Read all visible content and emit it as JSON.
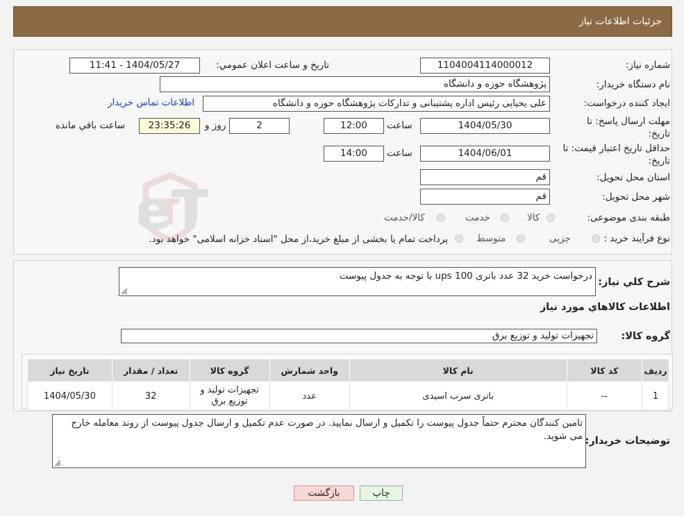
{
  "header": {
    "title": "جزئیات اطلاعات نیاز"
  },
  "form": {
    "need_number_label": "شماره نیاز:",
    "need_number": "1104004114000012",
    "announce_label": "تاریخ و ساعت اعلان عمومي:",
    "announce_value": "1404/05/27 - 11:41",
    "buyer_org_label": "نام دستگاه خریدار:",
    "buyer_org": "پژوهشگاه حوزه و دانشگاه",
    "requester_label": "ایجاد کننده درخواست:",
    "requester": "علی یحیایی رئیس اداره پشتیبانی و تدارکات پژوهشگاه حوزه و دانشگاه",
    "contact_link": "اطلاعات تماس خریدار",
    "reply_deadline_label": "مهلت ارسال پاسخ: تا تاریخ:",
    "reply_date": "1404/05/30",
    "time_label": "ساعت",
    "reply_time": "12:00",
    "days": "2",
    "days_label": "روز و",
    "remaining": "23:35:26",
    "remaining_label": "ساعت باقي مانده",
    "price_validity_label": "حداقل تاریخ اعتبار قیمت: تا تاریخ:",
    "validity_date": "1404/06/01",
    "validity_time": "14:00",
    "province_label": "استان محل تحویل:",
    "province": "قم",
    "city_label": "شهر محل تحویل:",
    "city": "قم",
    "category_label": "طبقه بندی موضوعی:",
    "category_options": [
      "کالا",
      "خدمت",
      "کالا/خدمت"
    ],
    "process_label": "نوع فرآیند خرید :",
    "process_options": [
      "جزیی",
      "متوسط"
    ],
    "process_note": "پرداخت تمام یا بخشی از مبلغ خرید،از محل \"اسناد خزانه اسلامی\" خواهد بود."
  },
  "description": {
    "label": "شرح کلي نياز:",
    "text": "درخواست خرید 32 عدد باتری ups 100 با توجه به جدول پیوست"
  },
  "goods": {
    "section_title": "اطلاعات کالاهاي مورد نياز",
    "group_label": "گروه کالا:",
    "group_value": "تجهیزات تولید و توزیع برق",
    "table": {
      "headers": [
        "ردیف",
        "کد کالا",
        "نام کالا",
        "واحد شمارش",
        "گروه کالا",
        "تعداد / مقدار",
        "تاریخ نیاز"
      ],
      "rows": [
        [
          "1",
          "--",
          "باتری سرب اسیدی",
          "عدد",
          "تجهیزات تولید و توزیع برق",
          "32",
          "1404/05/30"
        ]
      ]
    }
  },
  "buyer_notes": {
    "label": "توضیحات خریدار:",
    "text": "تامین کنندگان محترم حتماً جدول پیوست را تکمیل و ارسال نمایید. در صورت عدم تکمیل و ارسال جدول پیوست از روند معامله خارج می شوید."
  },
  "buttons": {
    "print": "چاپ",
    "back": "بازگشت"
  },
  "watermark": {
    "text": "AriaTender.neT"
  },
  "colors": {
    "header": "#8a6b45",
    "link": "#1a3fd0",
    "back_button": "#f7d6d6",
    "print_button": "#e6f6e0"
  }
}
